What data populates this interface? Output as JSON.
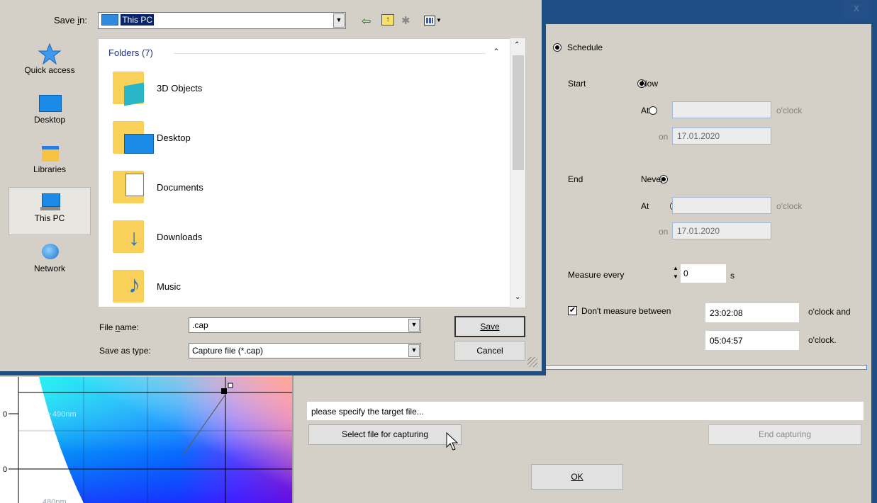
{
  "background_window": {
    "close_glyph": "x",
    "schedule": {
      "label": "Schedule",
      "selected": true
    },
    "start": {
      "label": "Start",
      "now_label": "Now",
      "at_label": "At",
      "time_value": "",
      "oclock": "o'clock",
      "on_label": "on",
      "date_value": "17.01.2020"
    },
    "end": {
      "label": "End",
      "never_label": "Never",
      "at_label": "At",
      "time_value": "",
      "oclock": "o'clock",
      "on_label": "on",
      "date_value": "17.01.2020"
    },
    "measure": {
      "label": "Measure every",
      "value": "0",
      "unit": "s"
    },
    "dont_measure": {
      "label": "Don't measure between",
      "checked": true,
      "from": "23:02:08",
      "from_suffix": "o'clock and",
      "to": "05:04:57",
      "to_suffix": "o'clock."
    },
    "target_file_text": "please specify the target file...",
    "select_file_button": "Select file for capturing",
    "end_capturing_button": "End capturing",
    "ok_button": "OK"
  },
  "chart": {
    "tick_labels": [
      "490nm",
      "480nm"
    ],
    "colors": {
      "cyan": "#00e8f0",
      "blue": "#1a35ff",
      "magenta": "#ff1fd0",
      "pink": "#ff8fa0"
    }
  },
  "save_dialog": {
    "save_in_label": "Save in:",
    "save_in_value": "This PC",
    "places": [
      {
        "label": "Quick access",
        "icon": "star-icon"
      },
      {
        "label": "Desktop",
        "icon": "desktop-icon"
      },
      {
        "label": "Libraries",
        "icon": "libraries-icon"
      },
      {
        "label": "This PC",
        "icon": "computer-icon",
        "selected": true
      },
      {
        "label": "Network",
        "icon": "network-icon"
      }
    ],
    "group_header": "Folders (7)",
    "folders": [
      "3D Objects",
      "Desktop",
      "Documents",
      "Downloads",
      "Music"
    ],
    "file_name_label": "File name:",
    "file_name_value": ".cap",
    "save_as_type_label": "Save as type:",
    "save_as_type_value": "Capture file (*.cap)",
    "save_button": "Save",
    "cancel_button": "Cancel"
  }
}
